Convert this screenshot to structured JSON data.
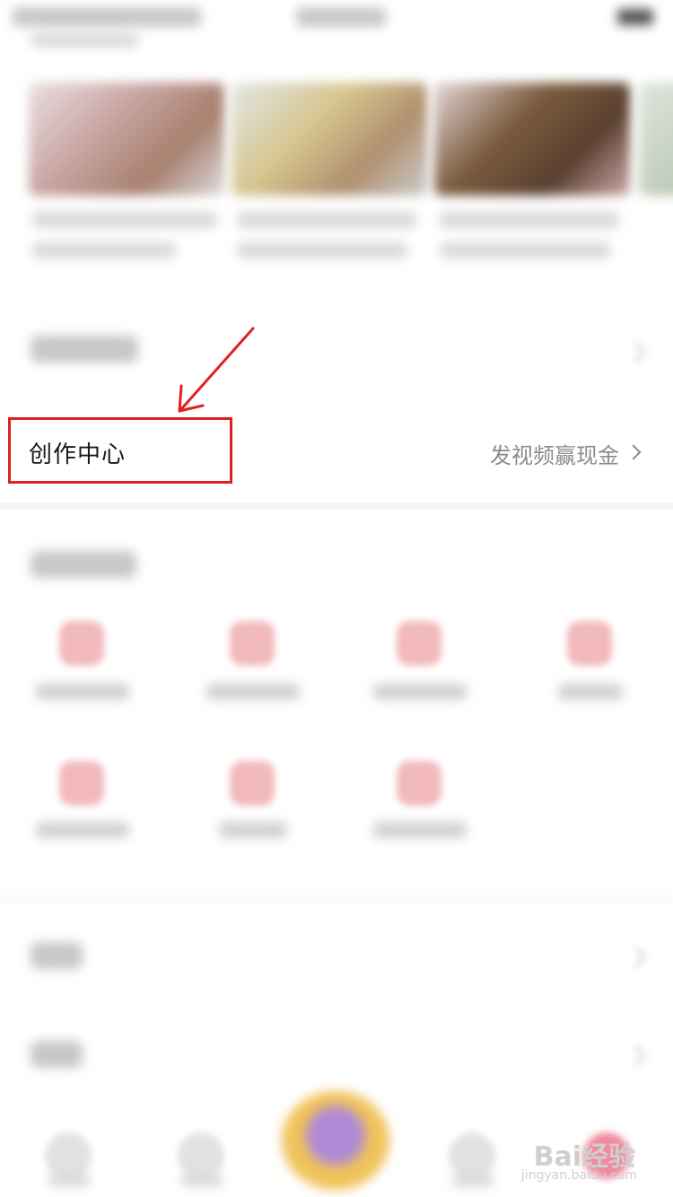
{
  "highlight_row": {
    "title": "创作中心",
    "link_text": "发视频赢现金"
  },
  "watermark": {
    "brand": "Bai经验",
    "url": "jingyan.baidu.com"
  },
  "colors": {
    "highlight_border": "#e02020",
    "arrow": "#e02020",
    "service_icon": "#f2b9bd",
    "link_text": "#8a8a8a"
  },
  "icons": [
    "chevron-right-icon",
    "arrow-annotation-icon"
  ]
}
